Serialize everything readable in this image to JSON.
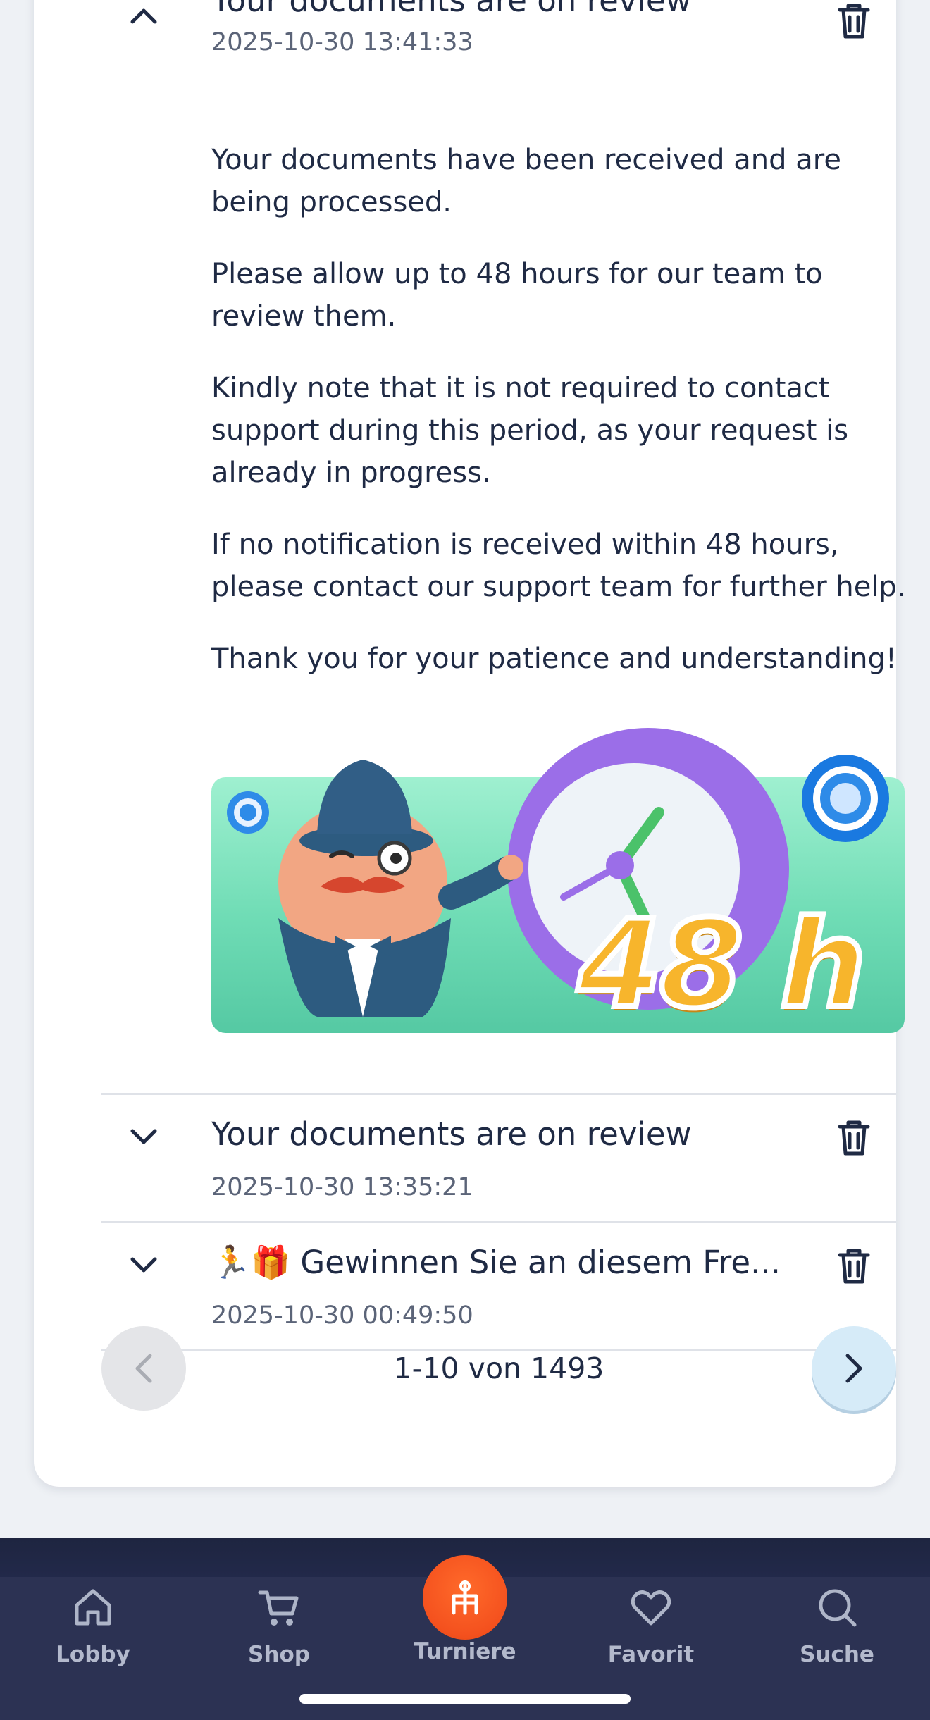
{
  "messages": [
    {
      "title": "Your documents are on review",
      "date": "2025-10-30 13:41:33",
      "expanded": true,
      "body": [
        "Your documents have been received and are being processed.",
        "Please allow up to 48 hours for our team to review them.",
        "Kindly note that it is not required to contact support during this period, as your request is already in progress.",
        "If no notification is received within 48 hours, please contact our support team for further help.",
        "Thank you for your patience and understanding!"
      ],
      "banner_text": "48 h"
    },
    {
      "title": "Your documents are on review",
      "date": "2025-10-30 13:35:21",
      "expanded": false
    },
    {
      "title": "🏃🎁 Gewinnen Sie an diesem Fre...",
      "date": "2025-10-30 00:49:50",
      "expanded": false
    }
  ],
  "pagination": {
    "label": "1-10 von 1493",
    "prev_icon": "chevron-left-icon",
    "next_icon": "chevron-right-icon"
  },
  "nav": [
    {
      "label": "Lobby",
      "icon": "home-icon"
    },
    {
      "label": "Shop",
      "icon": "cart-icon"
    },
    {
      "label": "Turniere",
      "icon": "tournament-icon"
    },
    {
      "label": "Favorit",
      "icon": "heart-icon"
    },
    {
      "label": "Suche",
      "icon": "search-icon"
    }
  ],
  "colors": {
    "accent": "#f4511e",
    "text": "#1f2a44",
    "muted": "#5b6478",
    "nav_bg": "#2c3253",
    "banner_green": "#6fdcb5",
    "banner_gold": "#f7b52c"
  }
}
